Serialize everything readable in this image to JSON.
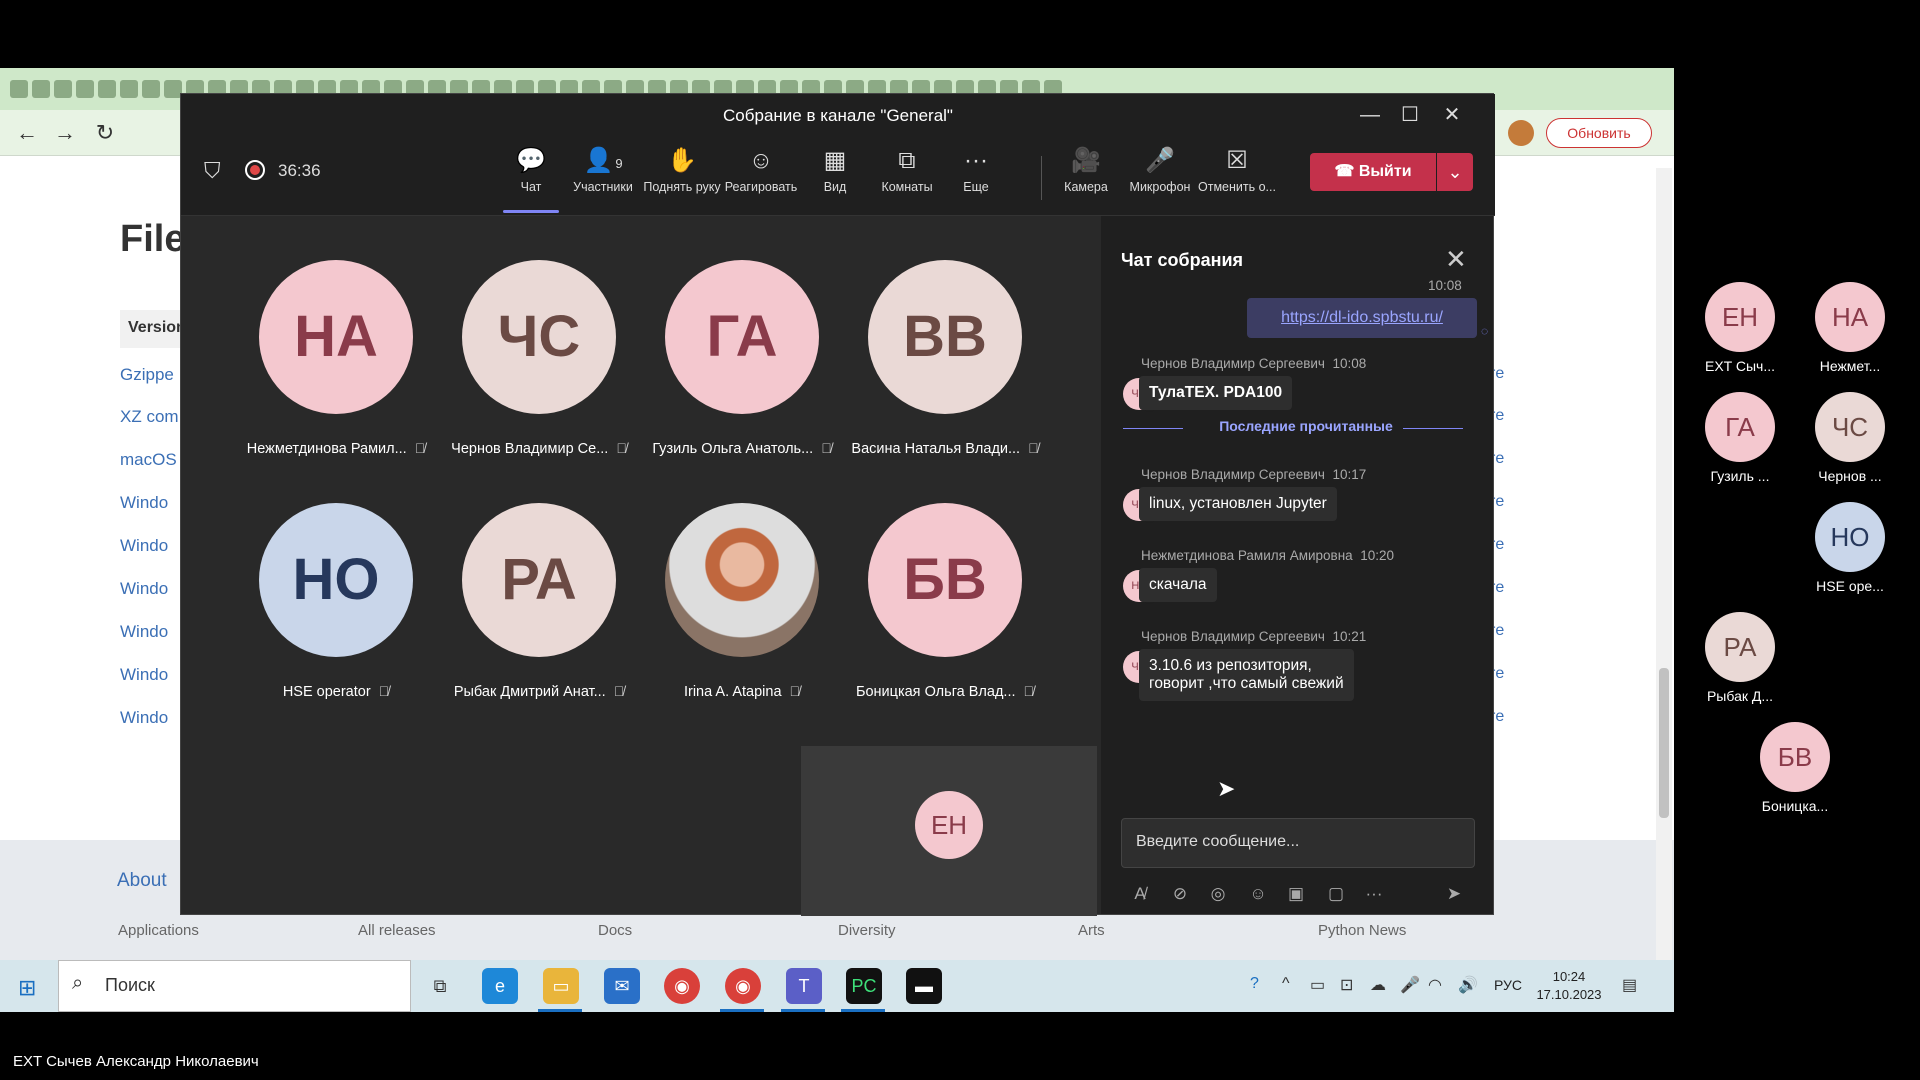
{
  "browser": {
    "update_label": "Обновить",
    "page_title": "File",
    "column_header": "Version",
    "rows": [
      "Gzippe",
      "XZ com",
      "macOS",
      "Windo",
      "Windo",
      "Windo",
      "Windo",
      "Windo",
      "Windo"
    ],
    "more_label": "re",
    "footer": {
      "about": "About",
      "links": [
        "Applications",
        "All releases",
        "Docs",
        "Diversity",
        "Arts",
        "Python News"
      ]
    }
  },
  "meeting": {
    "window_title": "Собрание в канале \"General\"",
    "timer": "36:36",
    "toolbar": [
      {
        "icon": "chat-icon",
        "glyph": "💬",
        "label": "Чат"
      },
      {
        "icon": "participants-icon",
        "glyph": "👤",
        "label": "Участники",
        "count": "9"
      },
      {
        "icon": "raise-hand-icon",
        "glyph": "✋",
        "label": "Поднять руку"
      },
      {
        "icon": "react-icon",
        "glyph": "☺",
        "label": "Реагировать"
      },
      {
        "icon": "view-icon",
        "glyph": "▦",
        "label": "Вид"
      },
      {
        "icon": "rooms-icon",
        "glyph": "⧉",
        "label": "Комнаты"
      },
      {
        "icon": "more-icon",
        "glyph": "···",
        "label": "Еще"
      },
      {
        "icon": "camera-off-icon",
        "glyph": "🎥",
        "label": "Камера"
      },
      {
        "icon": "mic-icon",
        "glyph": "🎤",
        "label": "Микрофон"
      },
      {
        "icon": "stop-share-icon",
        "glyph": "☒",
        "label": "Отменить о..."
      }
    ],
    "leave_label": "Выйти",
    "participants": [
      {
        "initials": "НА",
        "name": "Нежметдинова Рамил...",
        "bg": "#f4c8cf",
        "fg": "#8a3b4a"
      },
      {
        "initials": "ЧС",
        "name": "Чернов Владимир Се...",
        "bg": "#ead9d6",
        "fg": "#6b4a44"
      },
      {
        "initials": "ГА",
        "name": "Гузиль Ольга Анатоль...",
        "bg": "#f4c8cf",
        "fg": "#8a3b4a"
      },
      {
        "initials": "ВВ",
        "name": "Васина Наталья Влади...",
        "bg": "#ead9d6",
        "fg": "#6b4a44"
      },
      {
        "initials": "НО",
        "name": "HSE operator",
        "bg": "#c9d6ea",
        "fg": "#26385c"
      },
      {
        "initials": "РА",
        "name": "Рыбак Дмитрий Анат...",
        "bg": "#ead9d6",
        "fg": "#6b4a44"
      },
      {
        "initials": "",
        "name": "Irina A. Atapina",
        "bg": "#8a7466",
        "fg": "#fff"
      },
      {
        "initials": "БВ",
        "name": "Боницкая Ольга Влад...",
        "bg": "#f4c8cf",
        "fg": "#8a3b4a"
      }
    ],
    "self_initials": "ЕН",
    "chat": {
      "title": "Чат собрания",
      "first_time": "10:08",
      "link": "https://dl-ido.spbstu.ru/",
      "last_read": "Последние прочитанные",
      "messages": [
        {
          "author": "Чернов Владимир Сергеевич",
          "time": "10:08",
          "initials": "ЧС",
          "text": "ТулаТЕХ. PDA100"
        },
        {
          "author": "Чернов Владимир Сергеевич",
          "time": "10:17",
          "initials": "ЧС",
          "text": "linux, установлен Jupyter"
        },
        {
          "author": "Нежметдинова Рамиля Амировна",
          "time": "10:20",
          "initials": "НА",
          "text": "скачала"
        },
        {
          "author": "Чернов Владимир Сергеевич",
          "time": "10:21",
          "initials": "ЧС",
          "text": "3.10.6 из репозитория,\nговорит ,что самый свежий"
        }
      ],
      "compose_placeholder": "Введите сообщение..."
    }
  },
  "side_participants": [
    {
      "initials": "ЕН",
      "name": "EXT Сыч...",
      "bg": "#f4c8cf",
      "fg": "#8a3b4a"
    },
    {
      "initials": "НА",
      "name": "Нежмет...",
      "bg": "#f4c8cf",
      "fg": "#8a3b4a"
    },
    {
      "initials": "ГА",
      "name": "Гузиль ...",
      "bg": "#f4c8cf",
      "fg": "#8a3b4a"
    },
    {
      "initials": "ЧС",
      "name": "Чернов ...",
      "bg": "#ead9d6",
      "fg": "#6b4a44"
    },
    {
      "initials": "НО",
      "name": "HSE ope...",
      "bg": "#c9d6ea",
      "fg": "#26385c"
    },
    {
      "initials": "РА",
      "name": "Рыбак Д...",
      "bg": "#ead9d6",
      "fg": "#6b4a44"
    },
    {
      "initials": "БВ",
      "name": "Боницка...",
      "bg": "#f4c8cf",
      "fg": "#8a3b4a"
    }
  ],
  "taskbar": {
    "search_placeholder": "Поиск",
    "lang": "РУС",
    "time": "10:24",
    "date": "17.10.2023"
  },
  "caption": "EXT Сычев Александр Николаевич"
}
